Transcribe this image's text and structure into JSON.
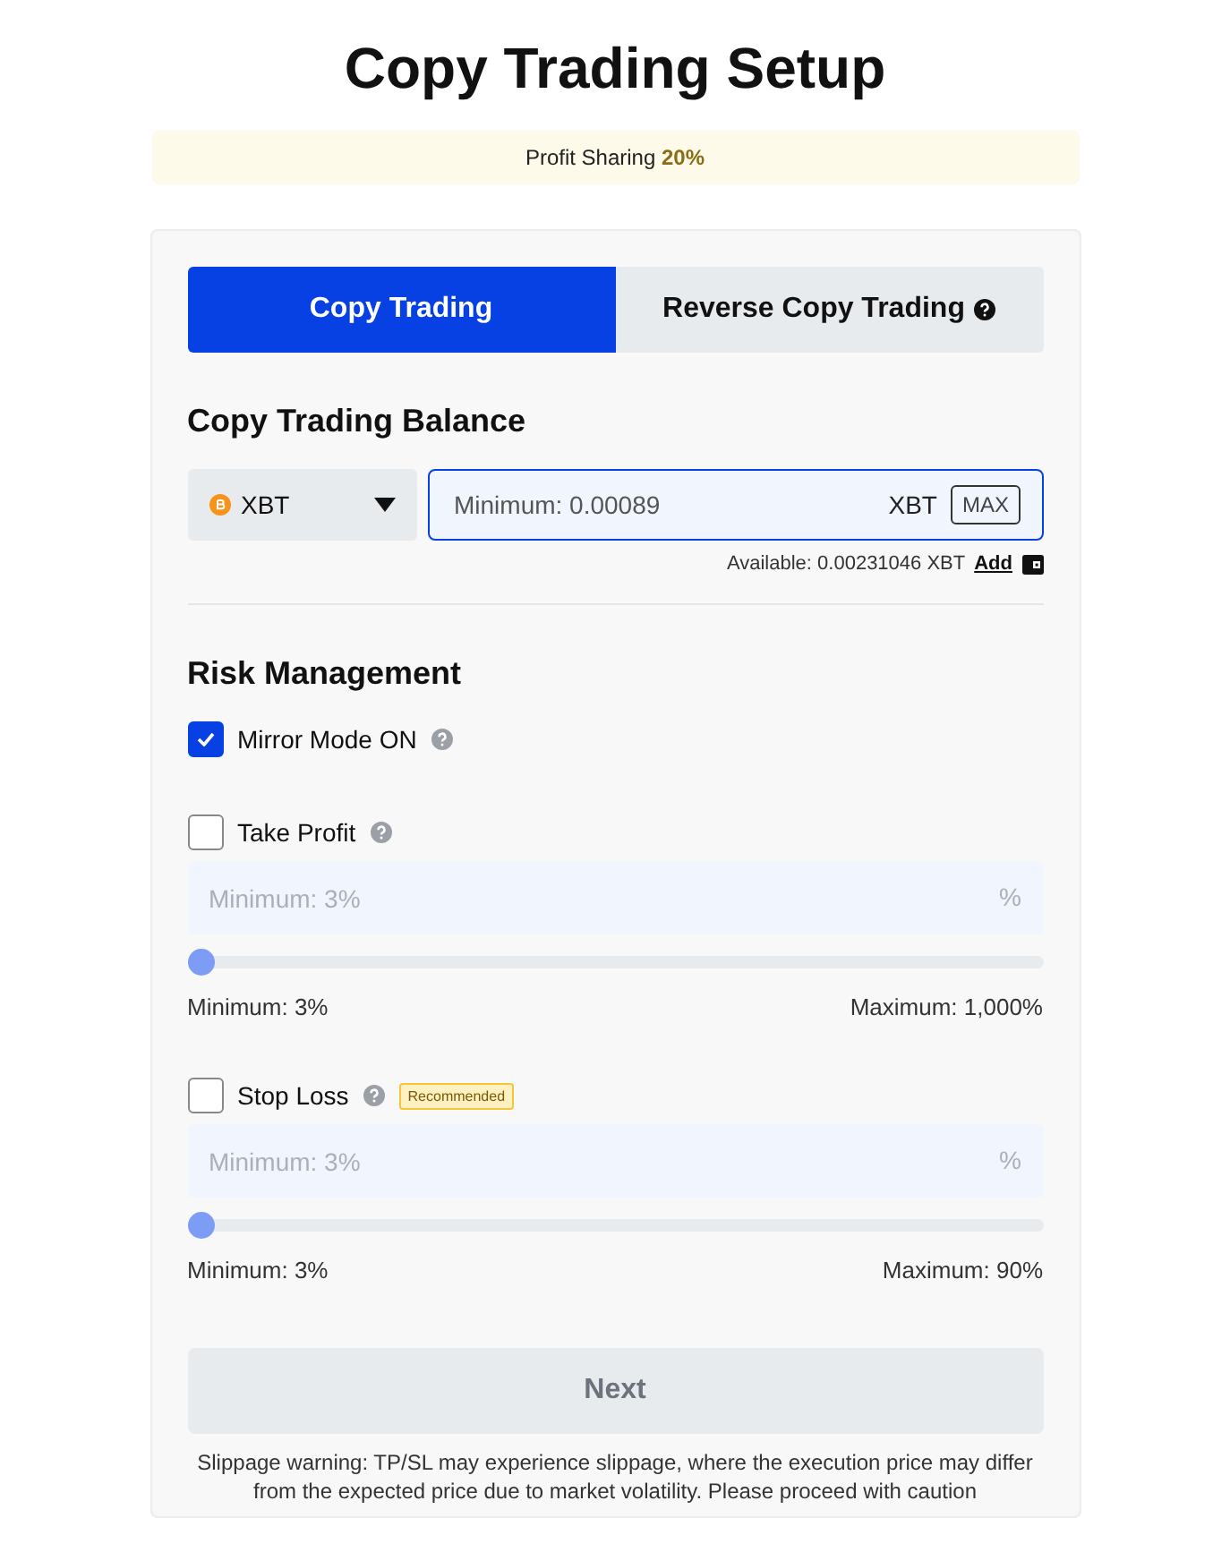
{
  "title": "Copy Trading Setup",
  "banner": {
    "label": "Profit Sharing",
    "value": "20%"
  },
  "tabs": [
    {
      "label": "Copy Trading",
      "selected": true,
      "help": false
    },
    {
      "label": "Reverse Copy Trading",
      "selected": false,
      "help": true
    }
  ],
  "balance": {
    "heading": "Copy Trading Balance",
    "currency": "XBT",
    "placeholder": "Minimum: 0.00089",
    "unit": "XBT",
    "max_button": "MAX",
    "available": "Available: 0.00231046 XBT",
    "add_link": "Add"
  },
  "risk": {
    "heading": "Risk Management",
    "mirror": {
      "label": "Mirror Mode ON",
      "checked": true
    },
    "options": [
      {
        "label": "Take Profit",
        "checked": false,
        "placeholder": "Minimum: 3%",
        "unit": "%",
        "level": 0,
        "min_label": "Minimum: 3%",
        "max_label": "Maximum: 1,000%"
      },
      {
        "label": "Stop Loss",
        "checked": false,
        "badge": "Recommended",
        "placeholder": "Minimum: 3%",
        "unit": "%",
        "level": 0,
        "min_label": "Minimum: 3%",
        "max_label": "Maximum: 90%"
      }
    ]
  },
  "next_button": {
    "label": "Next",
    "disabled": true
  },
  "warning": "Slippage warning: TP/SL may experience slippage, where the execution price may differ from the expected price due to market volatility. Please proceed with caution"
}
